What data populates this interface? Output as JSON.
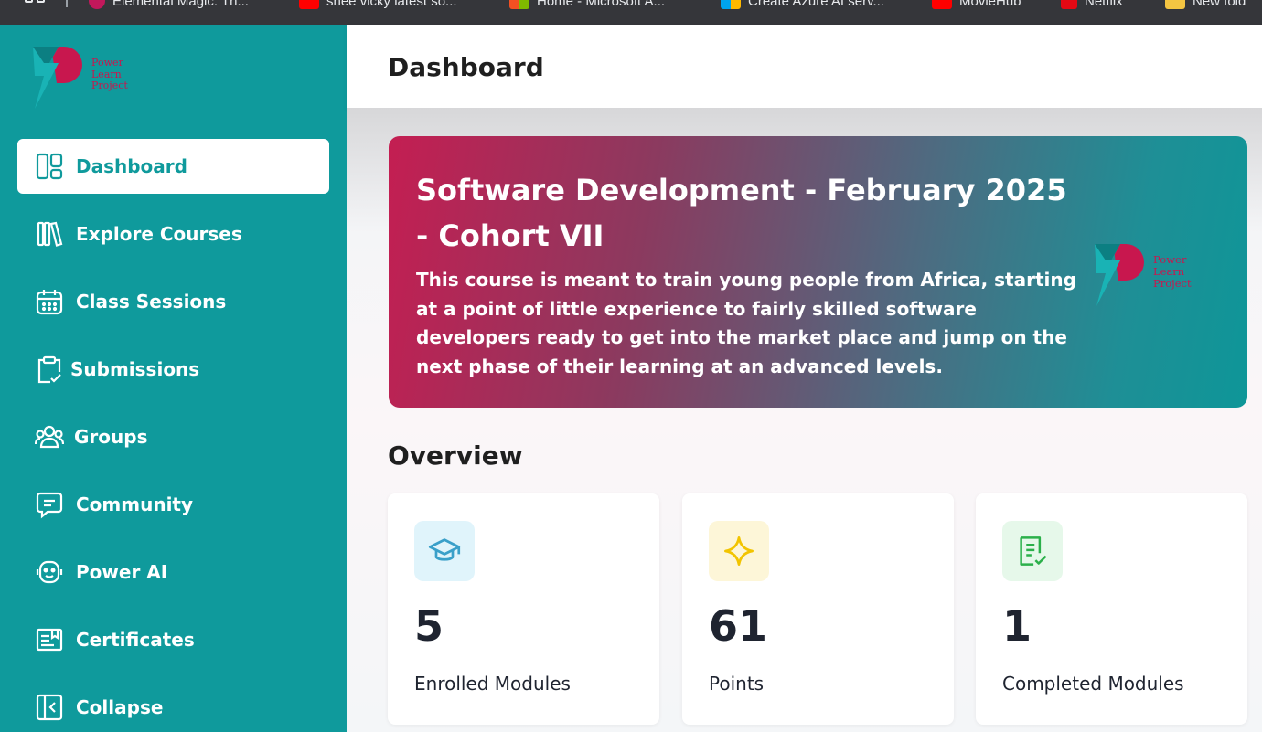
{
  "browser": {
    "bookmarks": [
      {
        "label": "Elemental Magic: Th...",
        "icon": "elemental-icon",
        "color": "#c2185b"
      },
      {
        "label": "shee vicky latest so...",
        "icon": "youtube-icon",
        "color": "#ff0000"
      },
      {
        "label": "Home - Microsoft A...",
        "icon": "microsoft-icon",
        "color": "#f25022"
      },
      {
        "label": "Create Azure AI serv...",
        "icon": "microsoft-icon",
        "color": "#f25022"
      },
      {
        "label": "MovieHub",
        "icon": "moviehub-icon",
        "color": "#ff0000"
      },
      {
        "label": "Netflix",
        "icon": "netflix-icon",
        "color": "#e50914"
      },
      {
        "label": "New fold",
        "icon": "folder-icon",
        "color": "#f4c542"
      }
    ]
  },
  "sidebar": {
    "logo": {
      "line1": "Power",
      "line2": "Learn",
      "line3": "Project"
    },
    "items": [
      {
        "label": "Dashboard",
        "icon": "dashboard-icon",
        "active": true
      },
      {
        "label": "Explore Courses",
        "icon": "books-icon"
      },
      {
        "label": "Class Sessions",
        "icon": "calendar-icon"
      },
      {
        "label": "Submissions",
        "icon": "clipboard-check-icon"
      },
      {
        "label": "Groups",
        "icon": "users-icon"
      },
      {
        "label": "Community",
        "icon": "chat-icon"
      },
      {
        "label": "Power AI",
        "icon": "robot-icon"
      },
      {
        "label": "Certificates",
        "icon": "certificate-icon"
      },
      {
        "label": "Collapse",
        "icon": "collapse-icon"
      }
    ]
  },
  "header": {
    "title": "Dashboard"
  },
  "banner": {
    "title": "Software Development - February 2025 - Cohort VII",
    "description": "This course is meant to train young people from Africa, starting at a point of little experience to fairly skilled software developers ready to get into the market place and jump on the next phase of their learning at an advanced levels."
  },
  "overview": {
    "title": "Overview",
    "cards": [
      {
        "value": "5",
        "label": "Enrolled Modules",
        "icon": "graduation-cap-icon",
        "icon_color": "#3aa0c9",
        "icon_bg": "#e0f4fb"
      },
      {
        "value": "61",
        "label": "Points",
        "icon": "sparkle-icon",
        "icon_color": "#f2c400",
        "icon_bg": "#fdf6d8"
      },
      {
        "value": "1",
        "label": "Completed Modules",
        "icon": "checklist-icon",
        "icon_color": "#2bb04a",
        "icon_bg": "#e6f8ea"
      }
    ]
  }
}
